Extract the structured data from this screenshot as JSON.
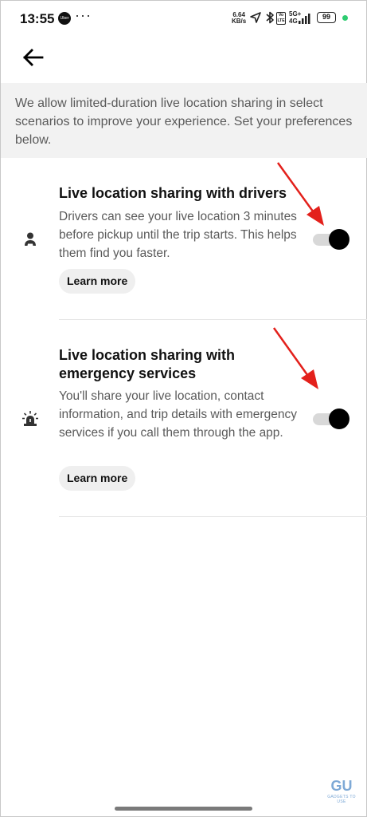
{
  "status_bar": {
    "time": "13:55",
    "app_badge": "Uber",
    "more": "···",
    "speed_value": "6.64",
    "speed_unit": "KB/s",
    "volte": "Vo LTE",
    "network": "5G+",
    "network_sub": "4G",
    "battery": "99",
    "icons": [
      "uber-icon",
      "navigation-icon",
      "bluetooth-icon",
      "signal-icon",
      "battery-icon"
    ],
    "dot_color": "#2ecc71"
  },
  "header": {
    "back_icon": "back-arrow-icon"
  },
  "intro": {
    "text": "We allow limited-duration live location sharing in select scenarios to improve your experience. Set  your preferences below."
  },
  "settings": [
    {
      "icon": "person-icon",
      "title": "Live location sharing with drivers",
      "description": "Drivers can see your live location 3 minutes before pickup until the trip starts. This helps them find you faster.",
      "learn_more": "Learn more",
      "enabled": true
    },
    {
      "icon": "emergency-siren-icon",
      "title": "Live location sharing with emergency services",
      "description": "You'll share your live location, contact information, and trip details with emergency services if you call them through the app.",
      "learn_more": "Learn more",
      "enabled": true
    }
  ],
  "colors": {
    "accent": "#000000",
    "annotation_arrow": "#e3201b",
    "banner_bg": "#f2f2f2",
    "secondary_text": "#5a5a5a"
  },
  "watermark": {
    "logo": "GU",
    "text": "GADGETS TO USE"
  }
}
